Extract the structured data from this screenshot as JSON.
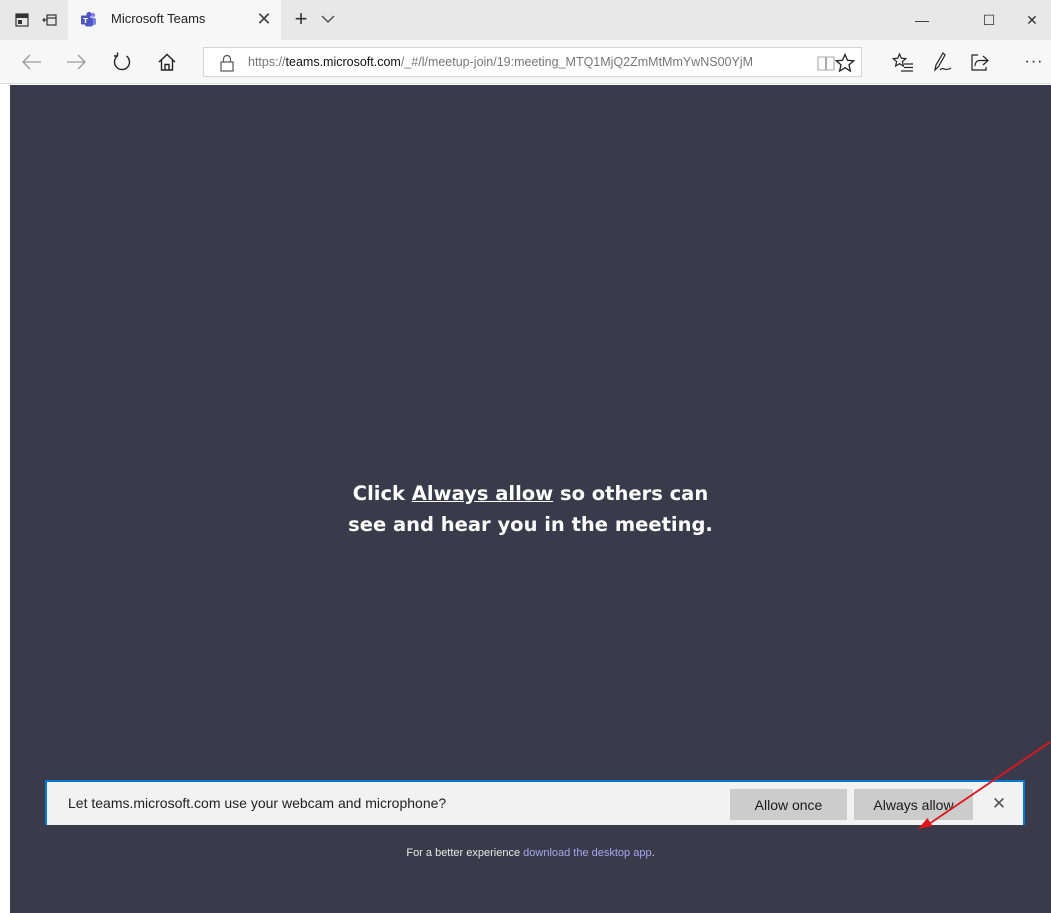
{
  "browser": {
    "tab": {
      "title": "Microsoft Teams",
      "close_glyph": "✕"
    },
    "new_tab_glyph": "+",
    "window": {
      "minimize_glyph": "—",
      "maximize_glyph": "☐",
      "close_glyph": "✕"
    },
    "address": {
      "scheme": "https://",
      "host": "teams.microsoft.com",
      "path": "/_#/l/meetup-join/19:meeting_MTQ1MjQ2ZmMtMmYwNS00YjM"
    },
    "more_glyph": "···"
  },
  "page": {
    "prompt_before": "Click ",
    "prompt_link": "Always allow",
    "prompt_after_line1": " so others can",
    "prompt_line2": "see and hear you in the meeting.",
    "better_text": "For a better experience ",
    "better_link": "download the desktop app",
    "better_end": "."
  },
  "permission": {
    "message": "Let teams.microsoft.com use your webcam and microphone?",
    "allow_once": "Allow once",
    "always_allow": "Always allow",
    "close_glyph": "✕"
  },
  "colors": {
    "content_bg": "#3b3a4a",
    "accent": "#0078d7",
    "link": "#a4a6f0",
    "annotation": "#e0161d"
  },
  "icons": [
    "tab-preview-icon",
    "tabs-aside-icon",
    "teams-logo-icon",
    "chevron-down-icon",
    "back-arrow-icon",
    "forward-arrow-icon",
    "refresh-icon",
    "home-icon",
    "lock-icon",
    "reading-view-icon",
    "favorite-star-icon",
    "favorites-list-icon",
    "pen-icon",
    "share-icon"
  ]
}
